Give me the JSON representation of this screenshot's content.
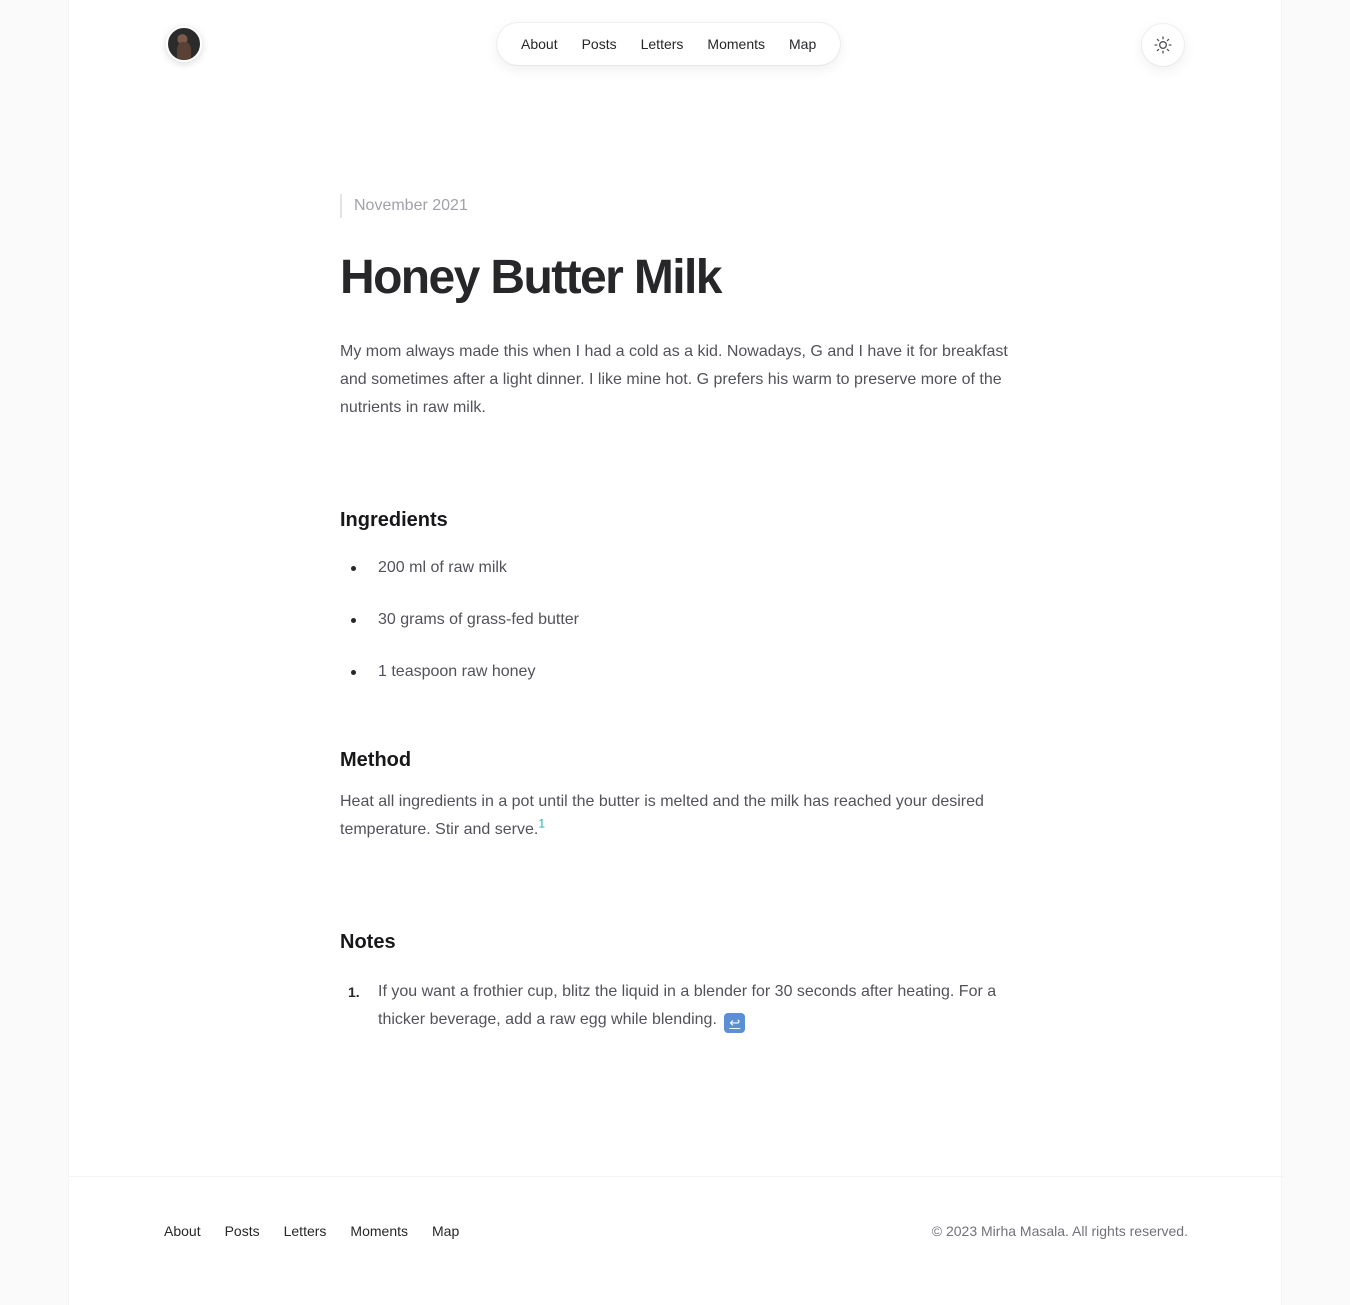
{
  "header": {
    "nav": [
      "About",
      "Posts",
      "Letters",
      "Moments",
      "Map"
    ],
    "theme_toggle_icon": "sun-icon"
  },
  "article": {
    "date": "November 2021",
    "title": "Honey Butter Milk",
    "intro": "My mom always made this when I had a cold as a kid. Nowadays, G and I have it for breakfast and sometimes after a light dinner. I like mine hot. G prefers his warm to preserve more of the nutrients in raw milk.",
    "ingredients_heading": "Ingredients",
    "ingredients": [
      "200 ml of raw milk",
      "30 grams of grass-fed butter",
      "1 teaspoon raw honey"
    ],
    "method_heading": "Method",
    "method_text": "Heat all ingredients in a pot until the butter is melted and the milk has reached your desired temperature. Stir and serve.",
    "footnote_ref": "1",
    "notes_heading": "Notes",
    "notes": [
      {
        "number": "1.",
        "text": "If you want a frothier cup, blitz the liquid in a blender for 30 seconds after heating. For a thicker beverage, add a raw egg while blending.",
        "backref": "↩"
      }
    ]
  },
  "footer": {
    "nav": [
      "About",
      "Posts",
      "Letters",
      "Moments",
      "Map"
    ],
    "copyright": "© 2023 Mirha Masala. All rights reserved."
  },
  "colors": {
    "accent": "#14b8a6",
    "backref_badge": "#5b8fd6"
  }
}
